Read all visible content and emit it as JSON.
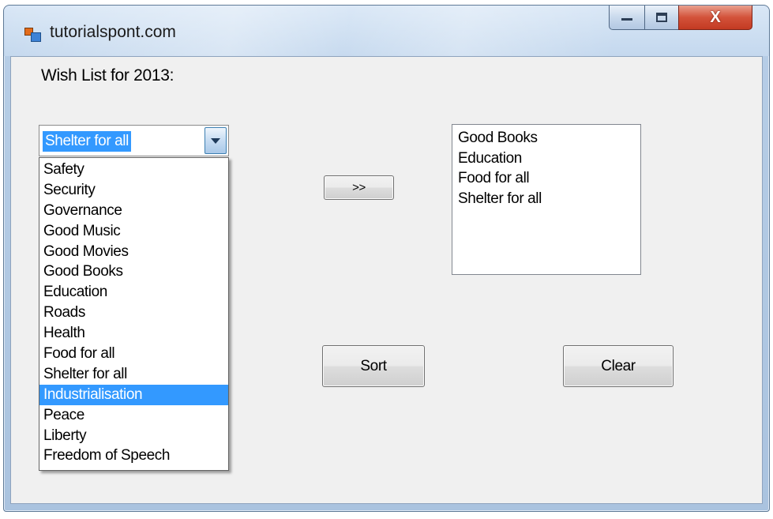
{
  "window": {
    "title": "tutorialspont.com",
    "controls": {
      "minimize_icon": "minimize-icon",
      "maximize_icon": "maximize-icon",
      "close_icon": "close-icon",
      "close_glyph": "X"
    }
  },
  "form": {
    "wish_label": "Wish List for 2013:",
    "combo": {
      "selected_value": "Shelter for all",
      "options": [
        "Safety",
        "Security",
        "Governance",
        "Good Music",
        "Good Movies",
        "Good Books",
        "Education",
        "Roads",
        "Health",
        "Food for all",
        "Shelter for all",
        "Industrialisation",
        "Peace",
        "Liberty",
        "Freedom of Speech"
      ],
      "highlighted_option": "Industrialisation"
    },
    "move_button_label": ">>",
    "wish_list_items": [
      "Good Books",
      "Education",
      "Food for all",
      "Shelter for all"
    ],
    "sort_button_label": "Sort",
    "clear_button_label": "Clear"
  },
  "colors": {
    "selection": "#3399ff",
    "client_background": "#f0f0f0",
    "close_button": "#c33a22"
  }
}
